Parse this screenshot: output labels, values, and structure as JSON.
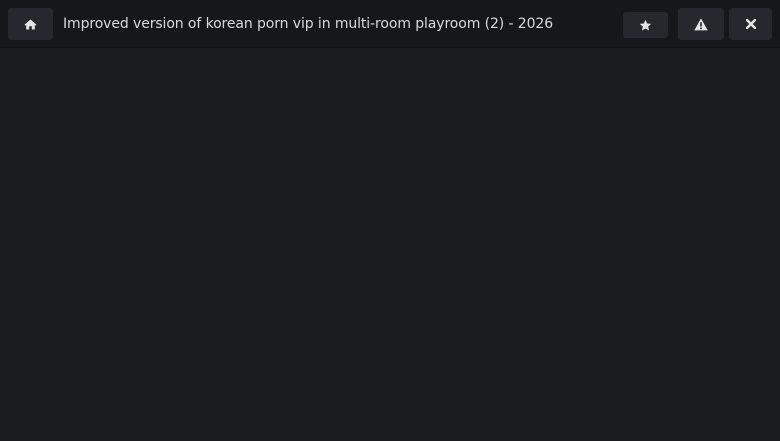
{
  "header": {
    "title": "Improved version of korean porn vip in multi-room playroom (2) - 2026"
  },
  "buttons": {
    "home": {
      "icon": "home-icon"
    },
    "favorite": {
      "icon": "star-icon"
    },
    "report": {
      "icon": "warning-icon"
    },
    "close": {
      "icon": "close-icon"
    }
  },
  "colors": {
    "background": "#1b1c20",
    "topbar": "#16171a",
    "button": "#26282d",
    "text": "#d8d9dc",
    "icon": "#e6e6e6"
  }
}
